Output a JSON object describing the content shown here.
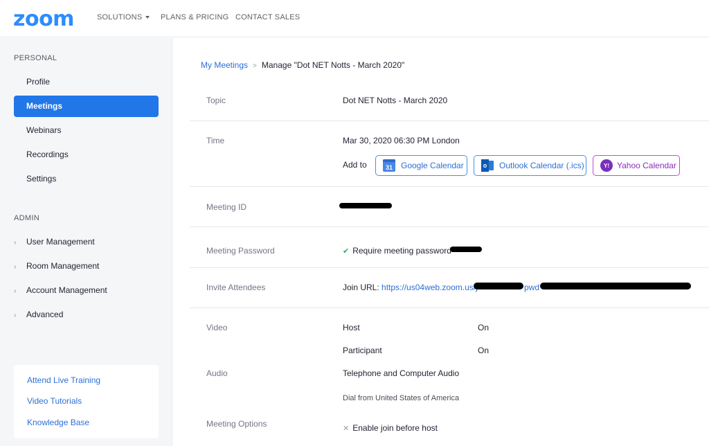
{
  "header": {
    "logo": "zoom",
    "nav": [
      {
        "label": "SOLUTIONS"
      },
      {
        "label": "PLANS & PRICING"
      },
      {
        "label": "CONTACT SALES"
      }
    ]
  },
  "sidebar": {
    "personal_label": "PERSONAL",
    "personal_items": [
      {
        "label": "Profile"
      },
      {
        "label": "Meetings"
      },
      {
        "label": "Webinars"
      },
      {
        "label": "Recordings"
      },
      {
        "label": "Settings"
      }
    ],
    "active_item": "Meetings",
    "admin_label": "ADMIN",
    "admin_items": [
      {
        "label": "User Management"
      },
      {
        "label": "Room Management"
      },
      {
        "label": "Account Management"
      },
      {
        "label": "Advanced"
      }
    ],
    "help_links": [
      {
        "label": "Attend Live Training"
      },
      {
        "label": "Video Tutorials"
      },
      {
        "label": "Knowledge Base"
      }
    ]
  },
  "breadcrumb": {
    "parent": "My Meetings",
    "current": "Manage \"Dot NET Notts - March 2020\""
  },
  "meeting": {
    "topic_label": "Topic",
    "topic": "Dot NET Notts - March 2020",
    "time_label": "Time",
    "time": "Mar 30, 2020 06:30 PM London",
    "add_to_label": "Add to",
    "calendars": {
      "google": "Google Calendar",
      "google_day": "31",
      "outlook": "Outlook Calendar (.ics)",
      "yahoo": "Yahoo Calendar"
    },
    "meeting_id_label": "Meeting ID",
    "password_label": "Meeting Password",
    "password_text": "Require meeting password",
    "invite_label": "Invite Attendees",
    "join_url_label": "Join URL:",
    "join_url_start": "https://us04web.zoom.us/j",
    "join_url_mid": "pwd",
    "video_label": "Video",
    "host_label": "Host",
    "host_value": "On",
    "participant_label": "Participant",
    "participant_value": "On",
    "audio_label": "Audio",
    "audio_value": "Telephone and Computer Audio",
    "dial_from": "Dial from United States of America",
    "options_label": "Meeting Options",
    "option_join_before_host": "Enable join before host"
  },
  "colors": {
    "brand": "#2d8cff",
    "active_nav": "#2176e8",
    "link": "#2d6fd6",
    "yahoo": "#c646d6"
  }
}
